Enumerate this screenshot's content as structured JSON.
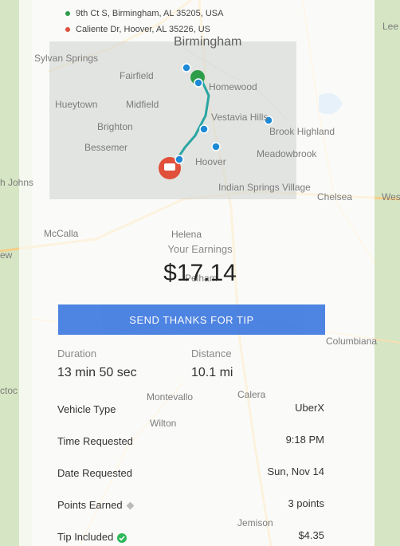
{
  "addresses": [
    {
      "text": "9th Ct S, Birmingham, AL 35205, USA",
      "color": "#2e9d4a"
    },
    {
      "text": "Caliente Dr, Hoover, AL 35226, US",
      "color": "#e0503a"
    }
  ],
  "map": {
    "labels": [
      "Birmingham",
      "Sylvan Springs",
      "Fairfield",
      "Homewood",
      "Hueytown",
      "Midfield",
      "Vestavia Hills",
      "Brighton",
      "Brook Highland",
      "Bessemer",
      "Meadowbrook",
      "Hoover",
      "Indian Springs Village",
      "Chelsea",
      "McCalla",
      "Helena",
      "Pelham",
      "Montevallo",
      "Calera",
      "Wilton",
      "Columbiana",
      "Jemison",
      "h Johns",
      "Wes",
      "Lee",
      "ctoc",
      "ew"
    ],
    "route_color": "#2aa6a3",
    "stop_color": "#1e8ad6"
  },
  "earnings": {
    "label": "Your Earnings",
    "amount": "$17.14"
  },
  "tip_button": {
    "label": "SEND THANKS FOR TIP"
  },
  "stats": {
    "duration_label": "Duration",
    "duration_value": "13 min 50 sec",
    "distance_label": "Distance",
    "distance_value": "10.1 mi"
  },
  "details": [
    {
      "label": "Vehicle Type",
      "value": "UberX",
      "icon": ""
    },
    {
      "label": "Time Requested",
      "value": "9:18 PM",
      "icon": ""
    },
    {
      "label": "Date Requested",
      "value": "Sun, Nov 14",
      "icon": ""
    },
    {
      "label": "Points Earned",
      "value": "3 points",
      "icon": "diamond-icon"
    },
    {
      "label": "Tip Included",
      "value": "$4.35",
      "icon": "check-circle-icon"
    }
  ],
  "colors": {
    "accent": "#3f79e0",
    "check": "#2eb85c"
  }
}
